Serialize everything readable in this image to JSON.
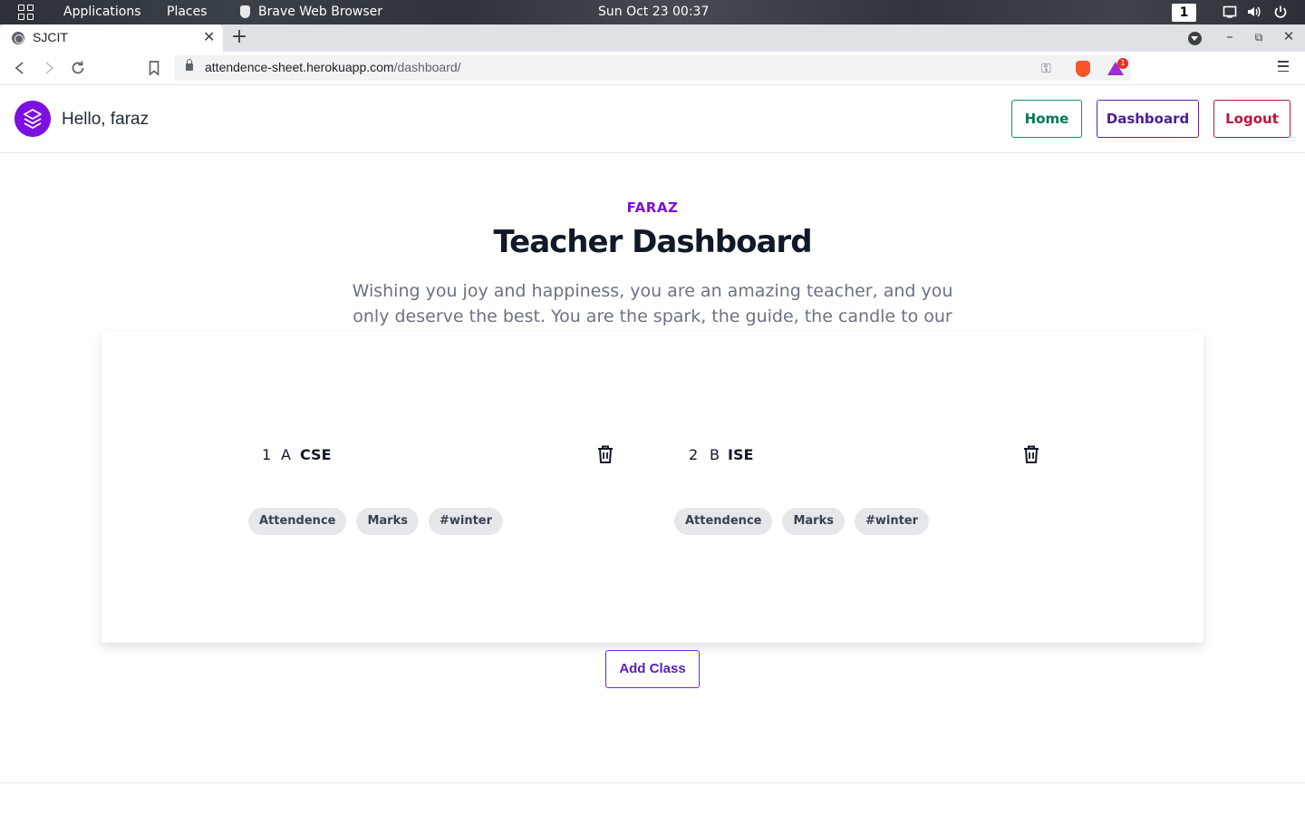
{
  "os": {
    "apps_label": "Applications",
    "places_label": "Places",
    "browser_label": "Brave Web Browser",
    "clock": "Sun Oct 23  00:37",
    "workspace": "1"
  },
  "browser": {
    "tab_title": "SJCIT",
    "url_host": "attendence-sheet.herokuapp.com",
    "url_path": "/dashboard/",
    "rewards_count": "1"
  },
  "header": {
    "greeting": "Hello, faraz",
    "home_label": "Home",
    "dashboard_label": "Dashboard",
    "logout_label": "Logout"
  },
  "hero": {
    "eyebrow": "FARAZ",
    "title": "Teacher Dashboard",
    "tagline": "Wishing you joy and happiness, you are an amazing teacher, and you only deserve the best. You are the spark, the guide, the candle to our lives."
  },
  "classes": [
    {
      "number": "1",
      "section": "A",
      "department": "CSE",
      "tags": [
        "Attendence",
        "Marks",
        "#winter"
      ]
    },
    {
      "number": "2",
      "section": "B",
      "department": "ISE",
      "tags": [
        "Attendence",
        "Marks",
        "#winter"
      ]
    }
  ],
  "actions": {
    "add_class_label": "Add Class"
  },
  "colors": {
    "brand": "#7c10e0",
    "home": "#047857",
    "dashboard": "#4c1d95",
    "logout": "#be123c"
  }
}
